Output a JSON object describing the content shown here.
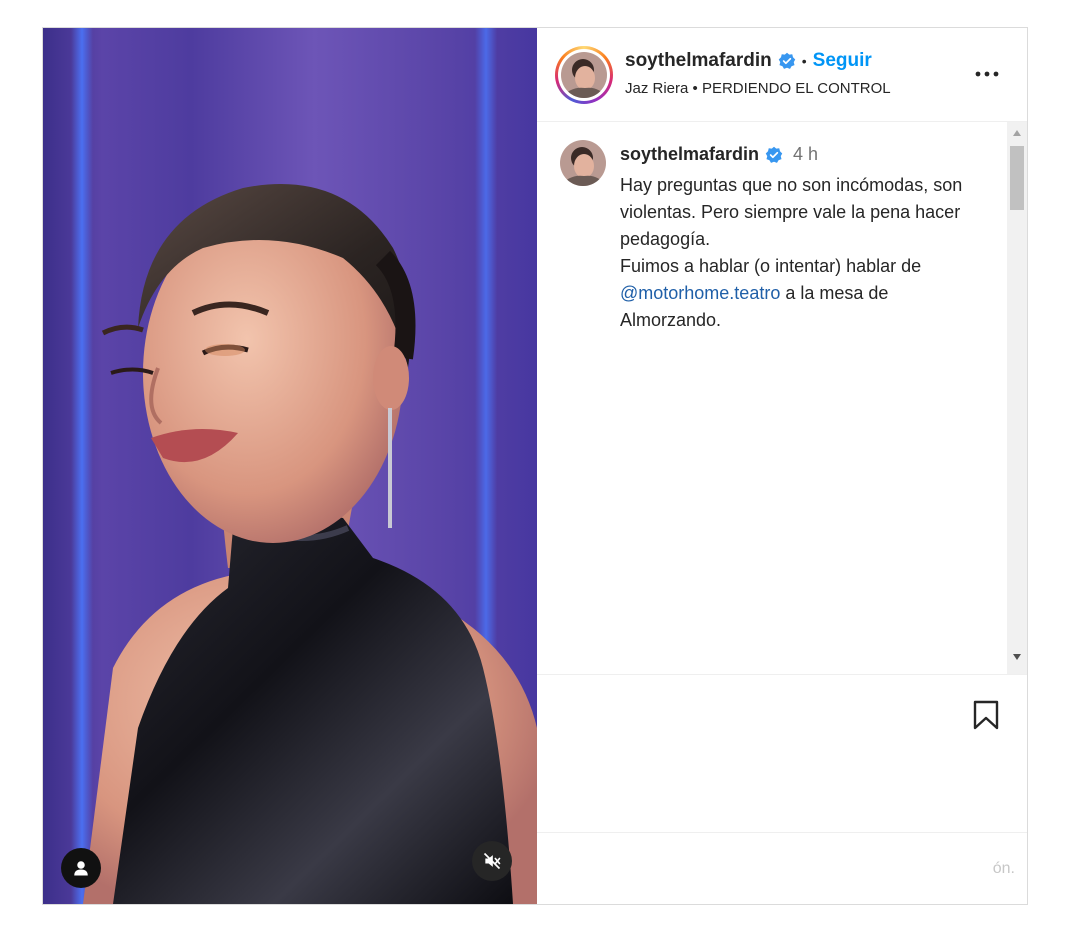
{
  "header": {
    "username": "soythelmafardin",
    "separator": "•",
    "follow_label": "Seguir",
    "audio_line": "Jaz Riera • PERDIENDO EL CONTROL",
    "more_icon": "more-horizontal-icon"
  },
  "caption": {
    "username": "soythelmafardin",
    "time": "4 h",
    "line1": "Hay preguntas que no son incómodas, son violentas. Pero siempre vale la pena hacer pedagogía.",
    "line2_before": "Fuimos a hablar (o intentar) hablar de ",
    "mention": "@motorhome.teatro",
    "line2_after": " a la mesa de Almorzando."
  },
  "comment_box": {
    "placeholder": "ón."
  },
  "colors": {
    "follow_blue": "#0095f6",
    "verified_blue": "#3897f0",
    "mention": "#1f5fa8"
  }
}
